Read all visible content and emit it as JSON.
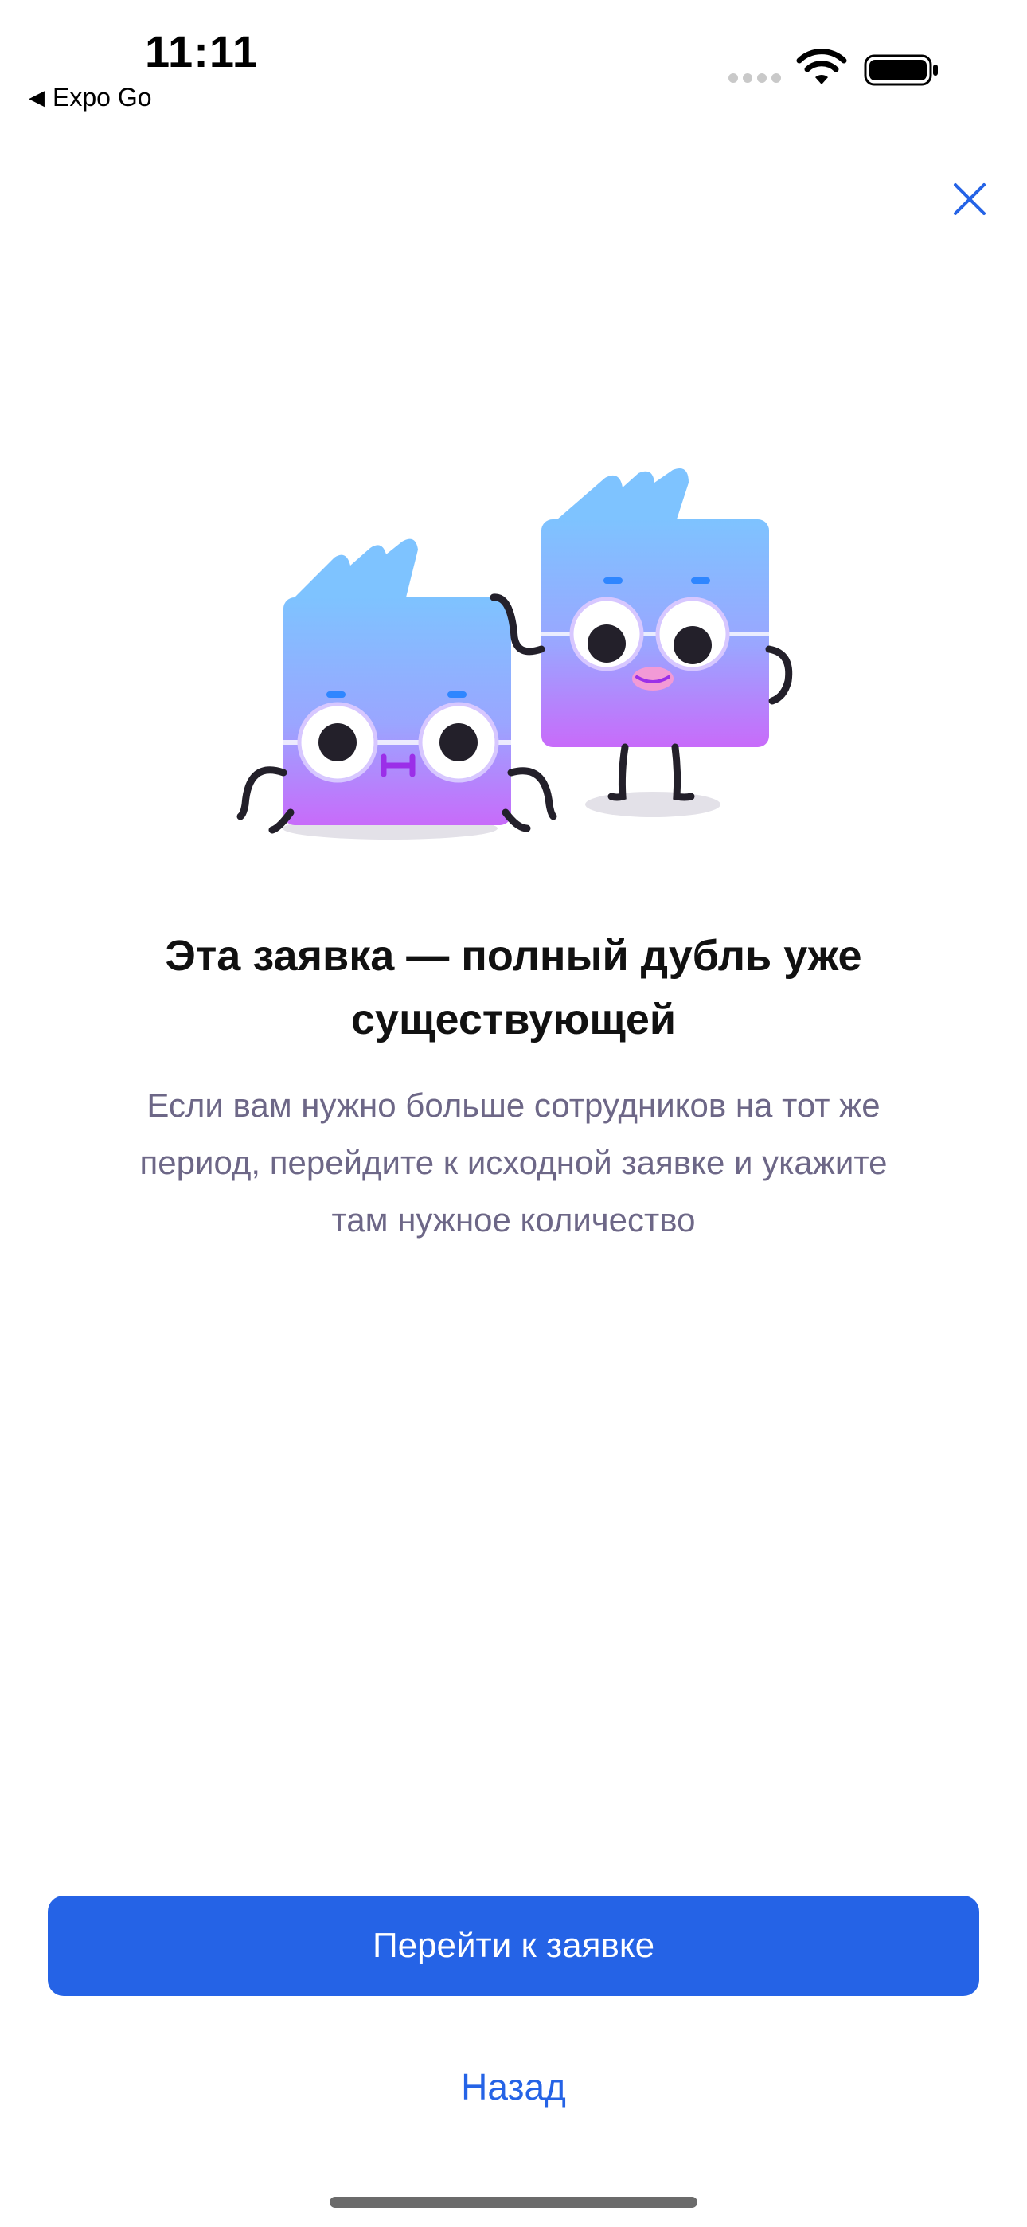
{
  "status_bar": {
    "time": "11:11",
    "back_app_label": "Expo Go",
    "back_icon": "triangle-left-icon",
    "wifi_icon": "wifi-icon",
    "battery_icon": "battery-icon"
  },
  "modal": {
    "close_icon": "close-icon",
    "title_line1": "Эта заявка — полный дубль уже",
    "title_line2": "существующей",
    "description_line1": "Если вам нужно больше сотрудников на тот же",
    "description_line2": "период, перейдите к исходной заявке и укажите",
    "description_line3": "там нужное количество",
    "primary_button_label": "Перейти к заявке",
    "secondary_button_label": "Назад"
  },
  "colors": {
    "accent": "#2563e6",
    "description_text": "#6d6787",
    "mascot_top": "#7ec3ff",
    "mascot_bottom": "#c86bfa"
  }
}
